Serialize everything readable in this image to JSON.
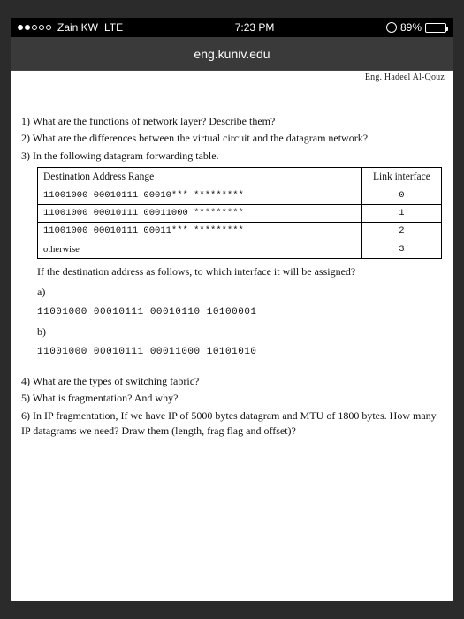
{
  "status": {
    "carrier": "Zain KW",
    "network": "LTE",
    "time": "7:23 PM",
    "battery_pct": "89%"
  },
  "nav": {
    "host": "eng.kuniv.edu"
  },
  "doc": {
    "partial_top": "Eng. Hadeel Al-Qouz",
    "q1": "1)  What are the functions of network layer? Describe them?",
    "q2": "2)  What are the differences between the virtual circuit and the datagram network?",
    "q3": "3)  In the following datagram forwarding table.",
    "table": {
      "head_range": "Destination Address Range",
      "head_iface": "Link interface",
      "rows": [
        {
          "range": "11001000 00010111 00010*** *********",
          "iface": "0"
        },
        {
          "range": "11001000 00010111 00011000 *********",
          "iface": "1"
        },
        {
          "range": "11001000 00010111 00011*** *********",
          "iface": "2"
        },
        {
          "range": "otherwise",
          "iface": "3"
        }
      ]
    },
    "follow": "If the destination address as follows, to which interface it will be assigned?",
    "fa_label": "a)",
    "fa_val": "11001000 00010111 00010110 10100001",
    "fb_label": "b)",
    "fb_val": "11001000 00010111 00011000 10101010",
    "q4": "4)  What are the types of switching fabric?",
    "q5": "5)  What is fragmentation? And why?",
    "q6": "6)  In IP fragmentation, If we have IP of 5000 bytes datagram and MTU of 1800 bytes. How many IP datagrams we need? Draw them (length, frag flag and offset)?"
  }
}
